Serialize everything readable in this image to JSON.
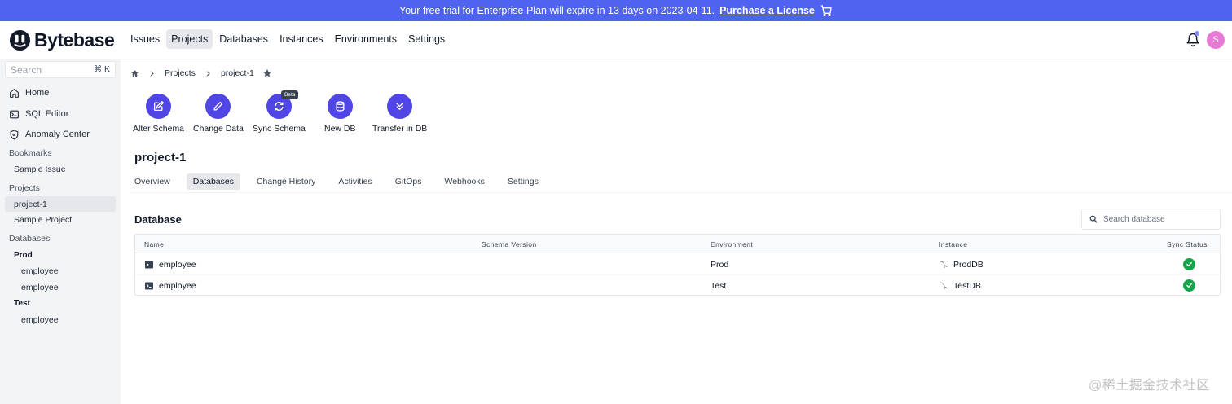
{
  "banner": {
    "message": "Your free trial for Enterprise Plan will expire in 13 days on 2023-04-11.",
    "link_label": "Purchase a License",
    "icon": "cart-icon"
  },
  "brand": {
    "name": "Bytebase",
    "color": "#4f63f0"
  },
  "topnav": [
    {
      "label": "Issues",
      "active": false
    },
    {
      "label": "Projects",
      "active": true
    },
    {
      "label": "Databases",
      "active": false
    },
    {
      "label": "Instances",
      "active": false
    },
    {
      "label": "Environments",
      "active": false
    },
    {
      "label": "Settings",
      "active": false
    }
  ],
  "user": {
    "avatar_initial": "S"
  },
  "sidebar": {
    "search_placeholder": "Search",
    "search_shortcut": "⌘ K",
    "items": [
      {
        "label": "Home",
        "icon": "home-icon"
      },
      {
        "label": "SQL Editor",
        "icon": "terminal-icon"
      },
      {
        "label": "Anomaly Center",
        "icon": "shield-icon"
      }
    ],
    "bookmarks_title": "Bookmarks",
    "bookmarks": [
      "Sample Issue"
    ],
    "projects_title": "Projects",
    "projects": [
      "project-1",
      "Sample Project"
    ],
    "databases_title": "Databases",
    "db_groups": [
      {
        "name": "Prod",
        "databases": [
          "employee",
          "employee"
        ]
      },
      {
        "name": "Test",
        "databases": [
          "employee"
        ]
      }
    ]
  },
  "breadcrumb": {
    "root_icon": "home-icon",
    "items": [
      "Projects",
      "project-1"
    ]
  },
  "actions": [
    {
      "label": "Alter Schema",
      "icon": "edit-icon"
    },
    {
      "label": "Change Data",
      "icon": "pencil-icon"
    },
    {
      "label": "Sync Schema",
      "icon": "sync-icon",
      "badge": "Beta"
    },
    {
      "label": "New DB",
      "icon": "database-icon"
    },
    {
      "label": "Transfer in DB",
      "icon": "chevrons-down-icon"
    }
  ],
  "project": {
    "title": "project-1"
  },
  "tabs": [
    {
      "label": "Overview",
      "active": false
    },
    {
      "label": "Databases",
      "active": true
    },
    {
      "label": "Change History",
      "active": false
    },
    {
      "label": "Activities",
      "active": false
    },
    {
      "label": "GitOps",
      "active": false
    },
    {
      "label": "Webhooks",
      "active": false
    },
    {
      "label": "Settings",
      "active": false
    }
  ],
  "database_section": {
    "heading": "Database",
    "search_placeholder": "Search database",
    "columns": [
      "Name",
      "Schema Version",
      "Environment",
      "Instance",
      "Sync Status"
    ],
    "rows": [
      {
        "name": "employee",
        "schema_version": "",
        "environment": "Prod",
        "instance": "ProdDB",
        "sync_status": "ok"
      },
      {
        "name": "employee",
        "schema_version": "",
        "environment": "Test",
        "instance": "TestDB",
        "sync_status": "ok"
      }
    ]
  },
  "watermark": "@稀土掘金技术社区",
  "colors": {
    "accent": "#4f46e5",
    "success": "#16a34a",
    "avatar": "#e879d4"
  }
}
